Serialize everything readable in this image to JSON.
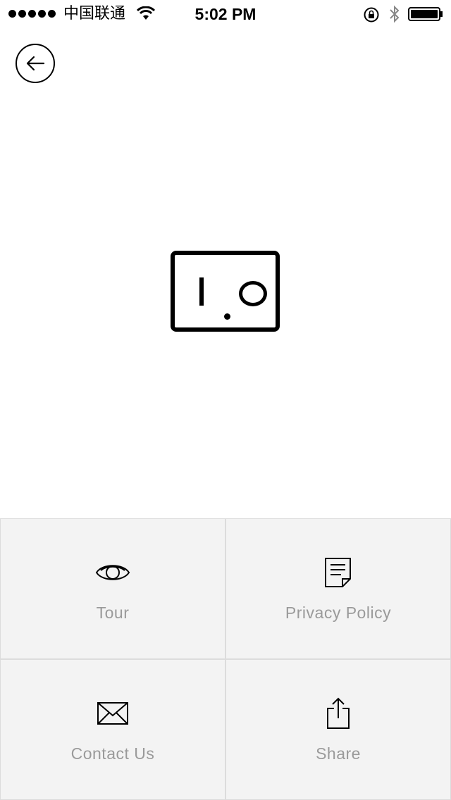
{
  "status_bar": {
    "carrier": "中国联通",
    "time": "5:02 PM"
  },
  "icons": {
    "back": "back-arrow-icon",
    "tour": "eye-icon",
    "privacy": "document-icon",
    "contact": "envelope-icon",
    "share": "share-icon"
  },
  "logo": {
    "text": "1.0"
  },
  "menu": {
    "tour": "Tour",
    "privacy_policy": "Privacy Policy",
    "contact_us": "Contact Us",
    "share": "Share"
  },
  "colors": {
    "tile_background": "#f3f3f3",
    "tile_label": "#9a9a9a",
    "divider": "#dcdcdc"
  }
}
